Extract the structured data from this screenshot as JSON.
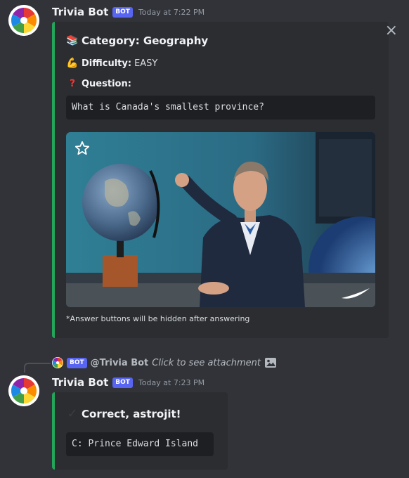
{
  "message1": {
    "username": "Trivia Bot",
    "bot_tag": "BOT",
    "timestamp": "Today at 7:22 PM",
    "embed": {
      "category_label": "Category: Geography",
      "difficulty_label": "Difficulty:",
      "difficulty_value": "EASY",
      "question_label": "Question:",
      "question_text": "What is Canada's smallest province?",
      "footer": "*Answer buttons will be hidden after answering",
      "accent_color": "#23a55a"
    }
  },
  "reply": {
    "bot_tag": "BOT",
    "mention": "@Trivia Bot",
    "text": "Click to see attachment"
  },
  "message2": {
    "username": "Trivia Bot",
    "bot_tag": "BOT",
    "timestamp": "Today at 7:23 PM",
    "embed": {
      "result_text": "Correct, astrojit!",
      "answer_text": "C: Prince Edward Island",
      "accent_color": "#23a55a"
    }
  },
  "icons": [
    "avatar-color-wheel",
    "close-icon",
    "books-icon",
    "flexed-biceps-icon",
    "question-mark-icon",
    "star-icon",
    "image-icon",
    "check-mark-icon"
  ],
  "colors": {
    "background": "#313338",
    "embed_bg": "#2b2d31",
    "bot_tag": "#5865f2",
    "code_bg": "#1e1f22"
  }
}
